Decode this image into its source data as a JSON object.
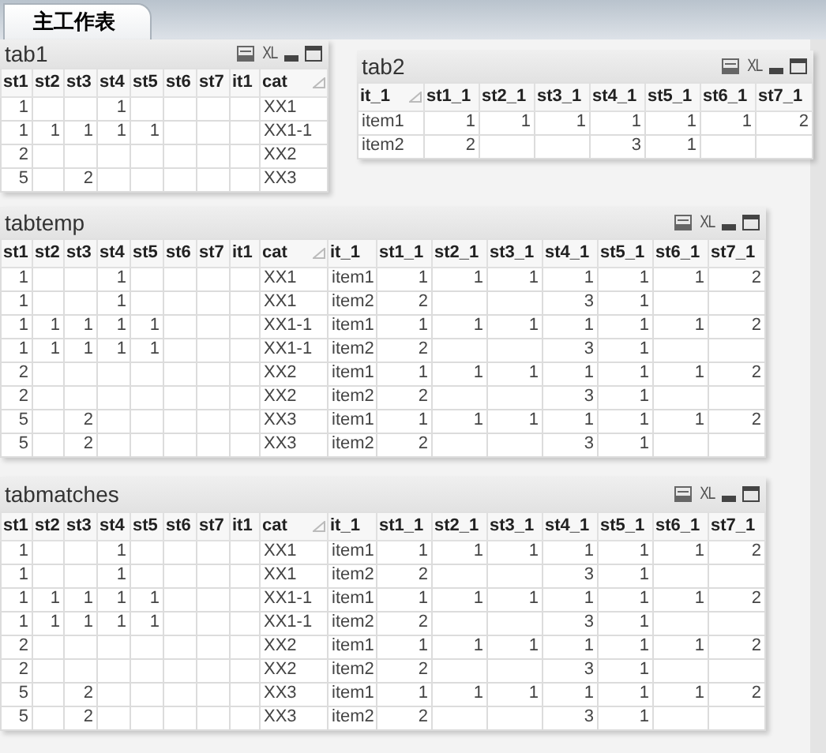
{
  "tabs": [
    {
      "label": "主工作表",
      "selected": true
    }
  ],
  "tables": [
    {
      "title": "tab1",
      "export_label": "XL",
      "columns": [
        {
          "label": "st1",
          "kind": "number",
          "sorted": false
        },
        {
          "label": "st2",
          "kind": "number",
          "sorted": false
        },
        {
          "label": "st3",
          "kind": "number",
          "sorted": false
        },
        {
          "label": "st4",
          "kind": "number",
          "sorted": false
        },
        {
          "label": "st5",
          "kind": "number",
          "sorted": false
        },
        {
          "label": "st6",
          "kind": "number",
          "sorted": false
        },
        {
          "label": "st7",
          "kind": "number",
          "sorted": false
        },
        {
          "label": "it1",
          "kind": "number",
          "sorted": false
        },
        {
          "label": "cat",
          "kind": "text",
          "sorted": true
        }
      ],
      "rows": [
        [
          "1",
          null,
          null,
          "1",
          null,
          null,
          null,
          null,
          "XX1"
        ],
        [
          "1",
          "1",
          "1",
          "1",
          "1",
          null,
          null,
          null,
          "XX1-1"
        ],
        [
          "2",
          null,
          null,
          null,
          null,
          null,
          null,
          null,
          "XX2"
        ],
        [
          "5",
          null,
          "2",
          null,
          null,
          null,
          null,
          null,
          "XX3"
        ]
      ]
    },
    {
      "title": "tab2",
      "export_label": "XL",
      "columns": [
        {
          "label": "it_1",
          "kind": "text",
          "sorted": true
        },
        {
          "label": "st1_1",
          "kind": "number",
          "sorted": false
        },
        {
          "label": "st2_1",
          "kind": "number",
          "sorted": false
        },
        {
          "label": "st3_1",
          "kind": "number",
          "sorted": false
        },
        {
          "label": "st4_1",
          "kind": "number",
          "sorted": false
        },
        {
          "label": "st5_1",
          "kind": "number",
          "sorted": false
        },
        {
          "label": "st6_1",
          "kind": "number",
          "sorted": false
        },
        {
          "label": "st7_1",
          "kind": "number",
          "sorted": false
        }
      ],
      "rows": [
        [
          "item1",
          "1",
          "1",
          "1",
          "1",
          "1",
          "1",
          "2"
        ],
        [
          "item2",
          "2",
          null,
          null,
          "3",
          "1",
          null,
          null
        ]
      ]
    },
    {
      "title": "tabtemp",
      "export_label": "XL",
      "columns": [
        {
          "label": "st1",
          "kind": "number",
          "sorted": false
        },
        {
          "label": "st2",
          "kind": "number",
          "sorted": false
        },
        {
          "label": "st3",
          "kind": "number",
          "sorted": false
        },
        {
          "label": "st4",
          "kind": "number",
          "sorted": false
        },
        {
          "label": "st5",
          "kind": "number",
          "sorted": false
        },
        {
          "label": "st6",
          "kind": "number",
          "sorted": false
        },
        {
          "label": "st7",
          "kind": "number",
          "sorted": false
        },
        {
          "label": "it1",
          "kind": "number",
          "sorted": false
        },
        {
          "label": "cat",
          "kind": "text",
          "sorted": true
        },
        {
          "label": "it_1",
          "kind": "text",
          "sorted": false
        },
        {
          "label": "st1_1",
          "kind": "number",
          "sorted": false
        },
        {
          "label": "st2_1",
          "kind": "number",
          "sorted": false
        },
        {
          "label": "st3_1",
          "kind": "number",
          "sorted": false
        },
        {
          "label": "st4_1",
          "kind": "number",
          "sorted": false
        },
        {
          "label": "st5_1",
          "kind": "number",
          "sorted": false
        },
        {
          "label": "st6_1",
          "kind": "number",
          "sorted": false
        },
        {
          "label": "st7_1",
          "kind": "number",
          "sorted": false
        }
      ],
      "rows": [
        [
          "1",
          null,
          null,
          "1",
          null,
          null,
          null,
          null,
          "XX1",
          "item1",
          "1",
          "1",
          "1",
          "1",
          "1",
          "1",
          "2"
        ],
        [
          "1",
          null,
          null,
          "1",
          null,
          null,
          null,
          null,
          "XX1",
          "item2",
          "2",
          null,
          null,
          "3",
          "1",
          null,
          null
        ],
        [
          "1",
          "1",
          "1",
          "1",
          "1",
          null,
          null,
          null,
          "XX1-1",
          "item1",
          "1",
          "1",
          "1",
          "1",
          "1",
          "1",
          "2"
        ],
        [
          "1",
          "1",
          "1",
          "1",
          "1",
          null,
          null,
          null,
          "XX1-1",
          "item2",
          "2",
          null,
          null,
          "3",
          "1",
          null,
          null
        ],
        [
          "2",
          null,
          null,
          null,
          null,
          null,
          null,
          null,
          "XX2",
          "item1",
          "1",
          "1",
          "1",
          "1",
          "1",
          "1",
          "2"
        ],
        [
          "2",
          null,
          null,
          null,
          null,
          null,
          null,
          null,
          "XX2",
          "item2",
          "2",
          null,
          null,
          "3",
          "1",
          null,
          null
        ],
        [
          "5",
          null,
          "2",
          null,
          null,
          null,
          null,
          null,
          "XX3",
          "item1",
          "1",
          "1",
          "1",
          "1",
          "1",
          "1",
          "2"
        ],
        [
          "5",
          null,
          "2",
          null,
          null,
          null,
          null,
          null,
          "XX3",
          "item2",
          "2",
          null,
          null,
          "3",
          "1",
          null,
          null
        ]
      ]
    },
    {
      "title": "tabmatches",
      "export_label": "XL",
      "columns": [
        {
          "label": "st1",
          "kind": "number",
          "sorted": false
        },
        {
          "label": "st2",
          "kind": "number",
          "sorted": false
        },
        {
          "label": "st3",
          "kind": "number",
          "sorted": false
        },
        {
          "label": "st4",
          "kind": "number",
          "sorted": false
        },
        {
          "label": "st5",
          "kind": "number",
          "sorted": false
        },
        {
          "label": "st6",
          "kind": "number",
          "sorted": false
        },
        {
          "label": "st7",
          "kind": "number",
          "sorted": false
        },
        {
          "label": "it1",
          "kind": "number",
          "sorted": false
        },
        {
          "label": "cat",
          "kind": "text",
          "sorted": true
        },
        {
          "label": "it_1",
          "kind": "text",
          "sorted": false
        },
        {
          "label": "st1_1",
          "kind": "number",
          "sorted": false
        },
        {
          "label": "st2_1",
          "kind": "number",
          "sorted": false
        },
        {
          "label": "st3_1",
          "kind": "number",
          "sorted": false
        },
        {
          "label": "st4_1",
          "kind": "number",
          "sorted": false
        },
        {
          "label": "st5_1",
          "kind": "number",
          "sorted": false
        },
        {
          "label": "st6_1",
          "kind": "number",
          "sorted": false
        },
        {
          "label": "st7_1",
          "kind": "number",
          "sorted": false
        }
      ],
      "rows": [
        [
          "1",
          null,
          null,
          "1",
          null,
          null,
          null,
          null,
          "XX1",
          "item1",
          "1",
          "1",
          "1",
          "1",
          "1",
          "1",
          "2"
        ],
        [
          "1",
          null,
          null,
          "1",
          null,
          null,
          null,
          null,
          "XX1",
          "item2",
          "2",
          null,
          null,
          "3",
          "1",
          null,
          null
        ],
        [
          "1",
          "1",
          "1",
          "1",
          "1",
          null,
          null,
          null,
          "XX1-1",
          "item1",
          "1",
          "1",
          "1",
          "1",
          "1",
          "1",
          "2"
        ],
        [
          "1",
          "1",
          "1",
          "1",
          "1",
          null,
          null,
          null,
          "XX1-1",
          "item2",
          "2",
          null,
          null,
          "3",
          "1",
          null,
          null
        ],
        [
          "2",
          null,
          null,
          null,
          null,
          null,
          null,
          null,
          "XX2",
          "item1",
          "1",
          "1",
          "1",
          "1",
          "1",
          "1",
          "2"
        ],
        [
          "2",
          null,
          null,
          null,
          null,
          null,
          null,
          null,
          "XX2",
          "item2",
          "2",
          null,
          null,
          "3",
          "1",
          null,
          null
        ],
        [
          "5",
          null,
          "2",
          null,
          null,
          null,
          null,
          null,
          "XX3",
          "item1",
          "1",
          "1",
          "1",
          "1",
          "1",
          "1",
          "2"
        ],
        [
          "5",
          null,
          "2",
          null,
          null,
          null,
          null,
          null,
          "XX3",
          "item2",
          "2",
          null,
          null,
          "3",
          "1",
          null,
          null
        ]
      ]
    }
  ]
}
